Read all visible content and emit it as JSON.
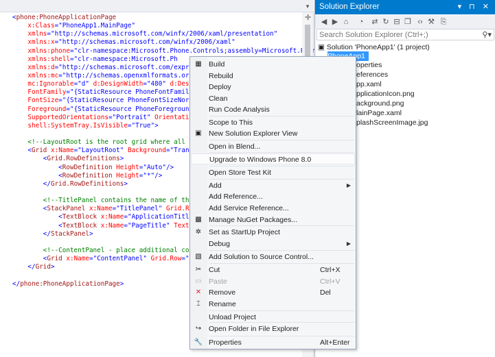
{
  "editor": {
    "lines": [
      [
        [
          "t-punct",
          "<"
        ],
        [
          "t-tag",
          "phone:PhoneApplicationPage"
        ]
      ],
      [
        [
          "t-plain",
          "    "
        ],
        [
          "t-attr",
          "x:Class"
        ],
        [
          "t-punct",
          "=\""
        ],
        [
          "t-val",
          "PhoneApp1.MainPage"
        ],
        [
          "t-punct",
          "\""
        ]
      ],
      [
        [
          "t-plain",
          "    "
        ],
        [
          "t-attr",
          "xmlns"
        ],
        [
          "t-punct",
          "=\""
        ],
        [
          "t-val",
          "http://schemas.microsoft.com/winfx/2006/xaml/presentation"
        ],
        [
          "t-punct",
          "\""
        ]
      ],
      [
        [
          "t-plain",
          "    "
        ],
        [
          "t-attr",
          "xmlns:x"
        ],
        [
          "t-punct",
          "=\""
        ],
        [
          "t-val",
          "http://schemas.microsoft.com/winfx/2006/xaml"
        ],
        [
          "t-punct",
          "\""
        ]
      ],
      [
        [
          "t-plain",
          "    "
        ],
        [
          "t-attr",
          "xmlns:phone"
        ],
        [
          "t-punct",
          "=\""
        ],
        [
          "t-val",
          "clr-namespace:Microsoft.Phone.Controls;assembly=Microsoft.Phone"
        ]
      ],
      [
        [
          "t-plain",
          "    "
        ],
        [
          "t-attr",
          "xmlns:shell"
        ],
        [
          "t-punct",
          "=\""
        ],
        [
          "t-val",
          "clr-namespace:Microsoft.Ph"
        ]
      ],
      [
        [
          "t-plain",
          "    "
        ],
        [
          "t-attr",
          "xmlns:d"
        ],
        [
          "t-punct",
          "=\""
        ],
        [
          "t-val",
          "http://schemas.microsoft.com/expres"
        ]
      ],
      [
        [
          "t-plain",
          "    "
        ],
        [
          "t-attr",
          "xmlns:mc"
        ],
        [
          "t-punct",
          "=\""
        ],
        [
          "t-val",
          "http://schemas.openxmlformats.org/m"
        ]
      ],
      [
        [
          "t-plain",
          "    "
        ],
        [
          "t-attr",
          "mc:Ignorable"
        ],
        [
          "t-punct",
          "=\""
        ],
        [
          "t-val",
          "d"
        ],
        [
          "t-punct",
          "\" "
        ],
        [
          "t-attr",
          "d:DesignWidth"
        ],
        [
          "t-punct",
          "=\""
        ],
        [
          "t-val",
          "480"
        ],
        [
          "t-punct",
          "\" "
        ],
        [
          "t-attr",
          "d:Design"
        ]
      ],
      [
        [
          "t-plain",
          "    "
        ],
        [
          "t-attr",
          "FontFamily"
        ],
        [
          "t-punct",
          "=\""
        ],
        [
          "t-val",
          "{StaticResource PhoneFontFamilyNo"
        ]
      ],
      [
        [
          "t-plain",
          "    "
        ],
        [
          "t-attr",
          "FontSize"
        ],
        [
          "t-punct",
          "=\""
        ],
        [
          "t-val",
          "{StaticResource PhoneFontSizeNormal"
        ]
      ],
      [
        [
          "t-plain",
          "    "
        ],
        [
          "t-attr",
          "Foreground"
        ],
        [
          "t-punct",
          "=\""
        ],
        [
          "t-val",
          "{StaticResource PhoneForegroundBr"
        ]
      ],
      [
        [
          "t-plain",
          "    "
        ],
        [
          "t-attr",
          "SupportedOrientations"
        ],
        [
          "t-punct",
          "=\""
        ],
        [
          "t-val",
          "Portrait"
        ],
        [
          "t-punct",
          "\" "
        ],
        [
          "t-attr",
          "Orientation"
        ],
        [
          "t-punct",
          "="
        ]
      ],
      [
        [
          "t-plain",
          "    "
        ],
        [
          "t-attr",
          "shell:SystemTray.IsVisible"
        ],
        [
          "t-punct",
          "=\""
        ],
        [
          "t-val",
          "True"
        ],
        [
          "t-punct",
          "\">"
        ]
      ],
      [
        [
          "t-plain",
          " "
        ]
      ],
      [
        [
          "t-plain",
          "    "
        ],
        [
          "t-comment",
          "<!--LayoutRoot is the root grid where all pag"
        ]
      ],
      [
        [
          "t-plain",
          "    "
        ],
        [
          "t-punct",
          "<"
        ],
        [
          "t-tag",
          "Grid"
        ],
        [
          "t-plain",
          " "
        ],
        [
          "t-attr",
          "x:Name"
        ],
        [
          "t-punct",
          "=\""
        ],
        [
          "t-val",
          "LayoutRoot"
        ],
        [
          "t-punct",
          "\" "
        ],
        [
          "t-attr",
          "Background"
        ],
        [
          "t-punct",
          "=\""
        ],
        [
          "t-val",
          "Transpa"
        ]
      ],
      [
        [
          "t-plain",
          "        "
        ],
        [
          "t-punct",
          "<"
        ],
        [
          "t-tag",
          "Grid.RowDefinitions"
        ],
        [
          "t-punct",
          ">"
        ]
      ],
      [
        [
          "t-plain",
          "            "
        ],
        [
          "t-punct",
          "<"
        ],
        [
          "t-tag",
          "RowDefinition"
        ],
        [
          "t-plain",
          " "
        ],
        [
          "t-attr",
          "Height"
        ],
        [
          "t-punct",
          "=\""
        ],
        [
          "t-val",
          "Auto"
        ],
        [
          "t-punct",
          "\"/>"
        ]
      ],
      [
        [
          "t-plain",
          "            "
        ],
        [
          "t-punct",
          "<"
        ],
        [
          "t-tag",
          "RowDefinition"
        ],
        [
          "t-plain",
          " "
        ],
        [
          "t-attr",
          "Height"
        ],
        [
          "t-punct",
          "=\""
        ],
        [
          "t-val",
          "*"
        ],
        [
          "t-punct",
          "\"/>"
        ]
      ],
      [
        [
          "t-plain",
          "        "
        ],
        [
          "t-punct",
          "</"
        ],
        [
          "t-tag",
          "Grid.RowDefinitions"
        ],
        [
          "t-punct",
          ">"
        ]
      ],
      [
        [
          "t-plain",
          " "
        ]
      ],
      [
        [
          "t-plain",
          "        "
        ],
        [
          "t-comment",
          "<!--TitlePanel contains the name of the a"
        ]
      ],
      [
        [
          "t-plain",
          "        "
        ],
        [
          "t-punct",
          "<"
        ],
        [
          "t-tag",
          "StackPanel"
        ],
        [
          "t-plain",
          " "
        ],
        [
          "t-attr",
          "x:Name"
        ],
        [
          "t-punct",
          "=\""
        ],
        [
          "t-val",
          "TitlePanel"
        ],
        [
          "t-punct",
          "\" "
        ],
        [
          "t-attr",
          "Grid.Row"
        ]
      ],
      [
        [
          "t-plain",
          "            "
        ],
        [
          "t-punct",
          "<"
        ],
        [
          "t-tag",
          "TextBlock"
        ],
        [
          "t-plain",
          " "
        ],
        [
          "t-attr",
          "x:Name"
        ],
        [
          "t-punct",
          "=\""
        ],
        [
          "t-val",
          "ApplicationTitle"
        ],
        [
          "t-punct",
          "\""
        ]
      ],
      [
        [
          "t-plain",
          "            "
        ],
        [
          "t-punct",
          "<"
        ],
        [
          "t-tag",
          "TextBlock"
        ],
        [
          "t-plain",
          " "
        ],
        [
          "t-attr",
          "x:Name"
        ],
        [
          "t-punct",
          "=\""
        ],
        [
          "t-val",
          "PageTitle"
        ],
        [
          "t-punct",
          "\" "
        ],
        [
          "t-attr",
          "Text"
        ],
        [
          "t-punct",
          "=\""
        ]
      ],
      [
        [
          "t-plain",
          "        "
        ],
        [
          "t-punct",
          "</"
        ],
        [
          "t-tag",
          "StackPanel"
        ],
        [
          "t-punct",
          ">"
        ]
      ],
      [
        [
          "t-plain",
          " "
        ]
      ],
      [
        [
          "t-plain",
          "        "
        ],
        [
          "t-comment",
          "<!--ContentPanel - place additional conte"
        ]
      ],
      [
        [
          "t-plain",
          "        "
        ],
        [
          "t-punct",
          "<"
        ],
        [
          "t-tag",
          "Grid"
        ],
        [
          "t-plain",
          " "
        ],
        [
          "t-attr",
          "x:Name"
        ],
        [
          "t-punct",
          "=\""
        ],
        [
          "t-val",
          "ContentPanel"
        ],
        [
          "t-punct",
          "\" "
        ],
        [
          "t-attr",
          "Grid.Row"
        ],
        [
          "t-punct",
          "=\""
        ],
        [
          "t-val",
          "1"
        ],
        [
          "t-punct",
          "\" "
        ]
      ],
      [
        [
          "t-plain",
          "    "
        ],
        [
          "t-punct",
          "</"
        ],
        [
          "t-tag",
          "Grid"
        ],
        [
          "t-punct",
          ">"
        ]
      ],
      [
        [
          "t-plain",
          " "
        ]
      ],
      [
        [
          "t-punct",
          "</"
        ],
        [
          "t-tag",
          "phone:PhoneApplicationPage"
        ],
        [
          "t-punct",
          ">"
        ]
      ]
    ]
  },
  "solution_explorer": {
    "title": "Solution Explorer",
    "title_icons": "▾ ⊓ ✕",
    "search_placeholder": "Search Solution Explorer (Ctrl+;)",
    "tree": [
      "Solution 'PhoneApp1' (1 project)",
      "PhoneApp1",
      "operties",
      "eferences",
      "pp.xaml",
      "pplicationIcon.png",
      "ackground.png",
      "lainPage.xaml",
      "plashScreenImage.jpg"
    ]
  },
  "context_menu": {
    "items": [
      {
        "label": "Build",
        "icon": "build-icon",
        "glyph": "▦"
      },
      {
        "label": "Rebuild"
      },
      {
        "label": "Deploy"
      },
      {
        "label": "Clean"
      },
      {
        "label": "Run Code Analysis"
      },
      {
        "label": "Scope to This"
      },
      {
        "label": "New Solution Explorer View",
        "icon": "new-view-icon",
        "glyph": "▣"
      },
      {
        "label": "Open in Blend..."
      },
      {
        "label": "Upgrade to Windows Phone 8.0"
      },
      {
        "label": "Open Store Test Kit"
      },
      {
        "label": "Add",
        "submenu": true
      },
      {
        "label": "Add Reference..."
      },
      {
        "label": "Add Service Reference..."
      },
      {
        "label": "Manage NuGet Packages...",
        "icon": "nuget-icon",
        "glyph": "▩"
      },
      {
        "label": "Set as StartUp Project",
        "icon": "gear-icon",
        "glyph": "✲"
      },
      {
        "label": "Debug",
        "submenu": true
      },
      {
        "label": "Add Solution to Source Control...",
        "icon": "source-control-icon",
        "glyph": "▧"
      },
      {
        "label": "Cut",
        "shortcut": "Ctrl+X",
        "icon": "scissors-icon",
        "glyph": "✂"
      },
      {
        "label": "Paste",
        "shortcut": "Ctrl+V",
        "icon": "paste-icon",
        "glyph": "▭",
        "disabled": true
      },
      {
        "label": "Remove",
        "shortcut": "Del",
        "icon": "remove-icon",
        "glyph": "✕"
      },
      {
        "label": "Rename",
        "icon": "rename-icon",
        "glyph": "⌶"
      },
      {
        "label": "Unload Project"
      },
      {
        "label": "Open Folder in File Explorer",
        "icon": "open-folder-icon",
        "glyph": "↪"
      },
      {
        "label": "Properties",
        "shortcut": "Alt+Enter",
        "icon": "wrench-icon",
        "glyph": "🔧"
      }
    ]
  },
  "colors": {
    "accent": "#007acc",
    "selection": "#3399ff",
    "remove_icon": "#d9262a"
  }
}
